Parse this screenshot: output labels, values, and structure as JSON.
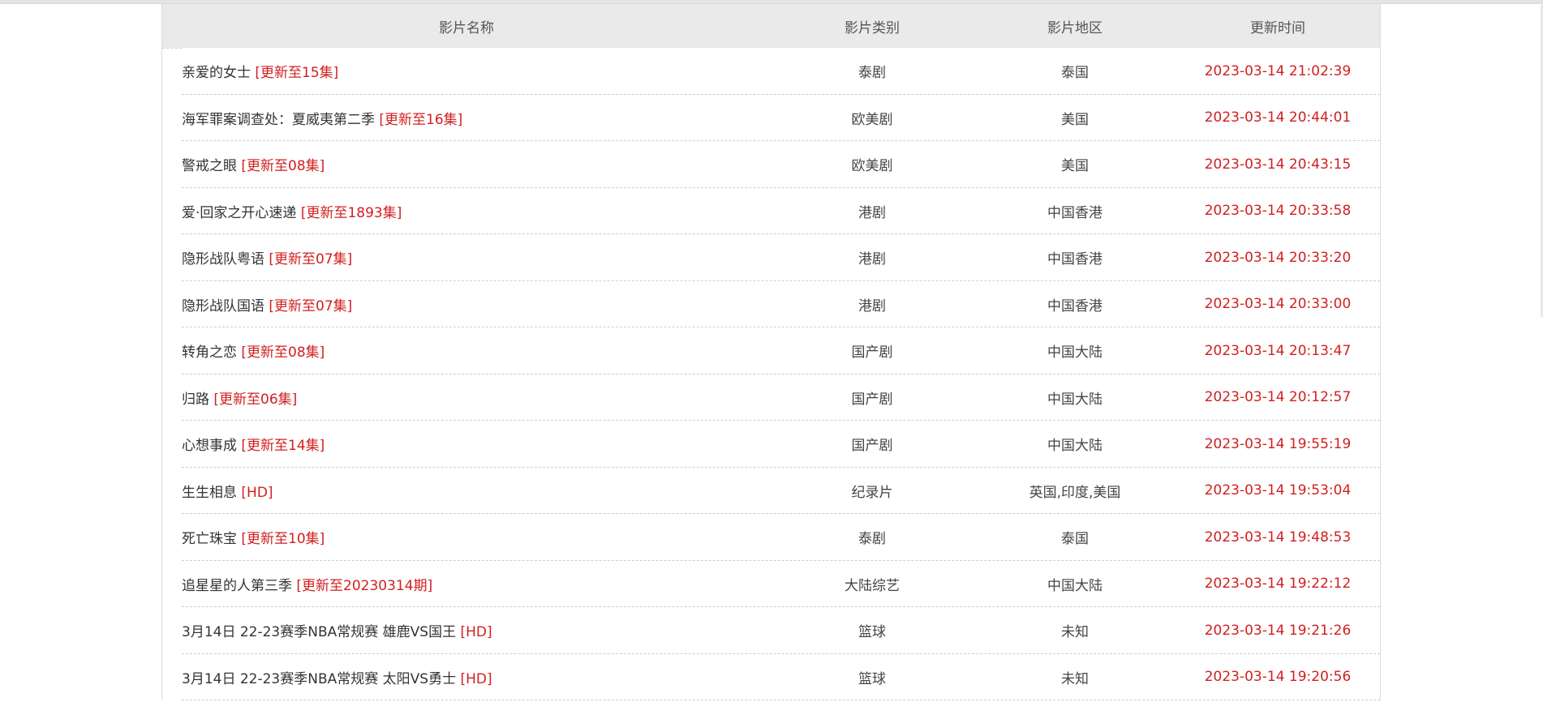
{
  "table": {
    "headers": {
      "title": "影片名称",
      "type": "影片类别",
      "region": "影片地区",
      "time": "更新时间"
    },
    "rows": [
      {
        "title": "亲爱的女士",
        "tag": "[更新至15集]",
        "type": "泰剧",
        "region": "泰国",
        "time": "2023-03-14 21:02:39"
      },
      {
        "title": "海军罪案调查处：夏威夷第二季",
        "tag": "[更新至16集]",
        "type": "欧美剧",
        "region": "美国",
        "time": "2023-03-14 20:44:01"
      },
      {
        "title": "警戒之眼",
        "tag": "[更新至08集]",
        "type": "欧美剧",
        "region": "美国",
        "time": "2023-03-14 20:43:15"
      },
      {
        "title": "爱·回家之开心速递",
        "tag": "[更新至1893集]",
        "type": "港剧",
        "region": "中国香港",
        "time": "2023-03-14 20:33:58"
      },
      {
        "title": "隐形战队粤语",
        "tag": "[更新至07集]",
        "type": "港剧",
        "region": "中国香港",
        "time": "2023-03-14 20:33:20"
      },
      {
        "title": "隐形战队国语",
        "tag": "[更新至07集]",
        "type": "港剧",
        "region": "中国香港",
        "time": "2023-03-14 20:33:00"
      },
      {
        "title": "转角之恋",
        "tag": "[更新至08集]",
        "type": "国产剧",
        "region": "中国大陆",
        "time": "2023-03-14 20:13:47"
      },
      {
        "title": "归路",
        "tag": "[更新至06集]",
        "type": "国产剧",
        "region": "中国大陆",
        "time": "2023-03-14 20:12:57"
      },
      {
        "title": "心想事成",
        "tag": "[更新至14集]",
        "type": "国产剧",
        "region": "中国大陆",
        "time": "2023-03-14 19:55:19"
      },
      {
        "title": "生生相息",
        "tag": "[HD]",
        "type": "纪录片",
        "region": "英国,印度,美国",
        "time": "2023-03-14 19:53:04"
      },
      {
        "title": "死亡珠宝",
        "tag": "[更新至10集]",
        "type": "泰剧",
        "region": "泰国",
        "time": "2023-03-14 19:48:53"
      },
      {
        "title": "追星星的人第三季",
        "tag": "[更新至20230314期]",
        "type": "大陆综艺",
        "region": "中国大陆",
        "time": "2023-03-14 19:22:12"
      },
      {
        "title": "3月14日 22-23赛季NBA常规赛 雄鹿VS国王",
        "tag": "[HD]",
        "type": "篮球",
        "region": "未知",
        "time": "2023-03-14 19:21:26"
      },
      {
        "title": "3月14日 22-23赛季NBA常规赛 太阳VS勇士",
        "tag": "[HD]",
        "type": "篮球",
        "region": "未知",
        "time": "2023-03-14 19:20:56"
      }
    ]
  }
}
